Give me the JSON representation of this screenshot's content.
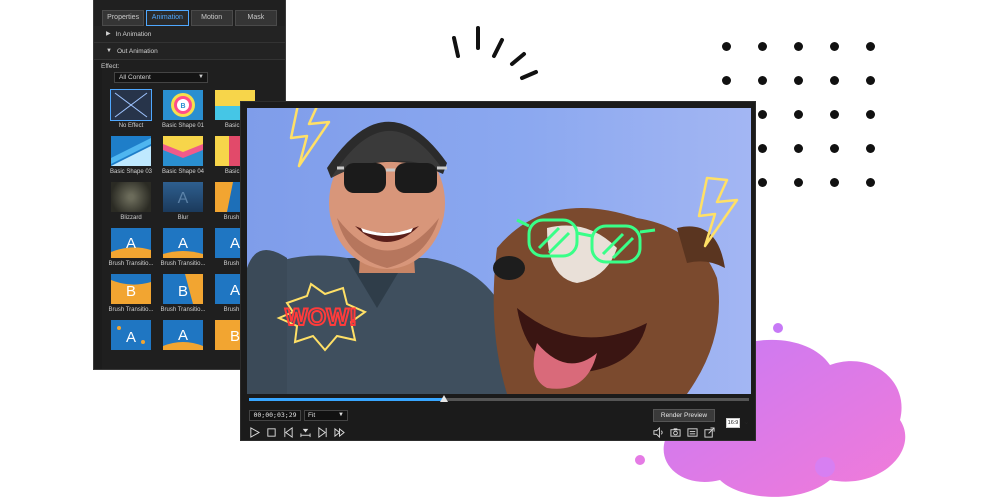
{
  "panel": {
    "tabs": [
      {
        "label": "Properties",
        "active": false
      },
      {
        "label": "Animation",
        "active": true
      },
      {
        "label": "Motion",
        "active": false
      },
      {
        "label": "Mask",
        "active": false
      }
    ],
    "sections": [
      {
        "label": "In Animation",
        "expanded": false
      },
      {
        "label": "Out Animation",
        "expanded": true
      }
    ],
    "effect_label": "Effect:",
    "effect_filter": "All Content",
    "effects": [
      {
        "label": "No Effect",
        "selected": true
      },
      {
        "label": "Basic Shape 01"
      },
      {
        "label": "Basic S"
      },
      {
        "label": "Basic Shape 03"
      },
      {
        "label": "Basic Shape 04"
      },
      {
        "label": "Basic S"
      },
      {
        "label": "Blizzard"
      },
      {
        "label": "Blur"
      },
      {
        "label": "Brush Tr"
      },
      {
        "label": "Brush Transitio..."
      },
      {
        "label": "Brush Transitio..."
      },
      {
        "label": "Brush Tr"
      },
      {
        "label": "Brush Transitio..."
      },
      {
        "label": "Brush Transitio..."
      },
      {
        "label": "Brush Tr"
      },
      {
        "label": ""
      },
      {
        "label": ""
      },
      {
        "label": ""
      }
    ]
  },
  "player": {
    "timecode": "00;00;03;29",
    "zoom": "Fit",
    "render_button": "Render Preview",
    "aspect_ratio": "16:9",
    "progress": 0.39,
    "sticker_text": "WOW!",
    "controls": [
      "play-icon",
      "stop-icon",
      "prev-frame-icon",
      "mark-icon",
      "next-frame-icon",
      "fast-forward-icon"
    ],
    "right_controls": [
      "volume-icon",
      "snapshot-icon",
      "subtitles-icon",
      "external-view-icon"
    ]
  },
  "colors": {
    "accent": "#4fa8ff",
    "timeline": "#38a6ff",
    "blob": "#e879f9",
    "neon_yellow": "#ffe066",
    "neon_green": "#39ff88",
    "neon_red": "#ff3b3b"
  }
}
